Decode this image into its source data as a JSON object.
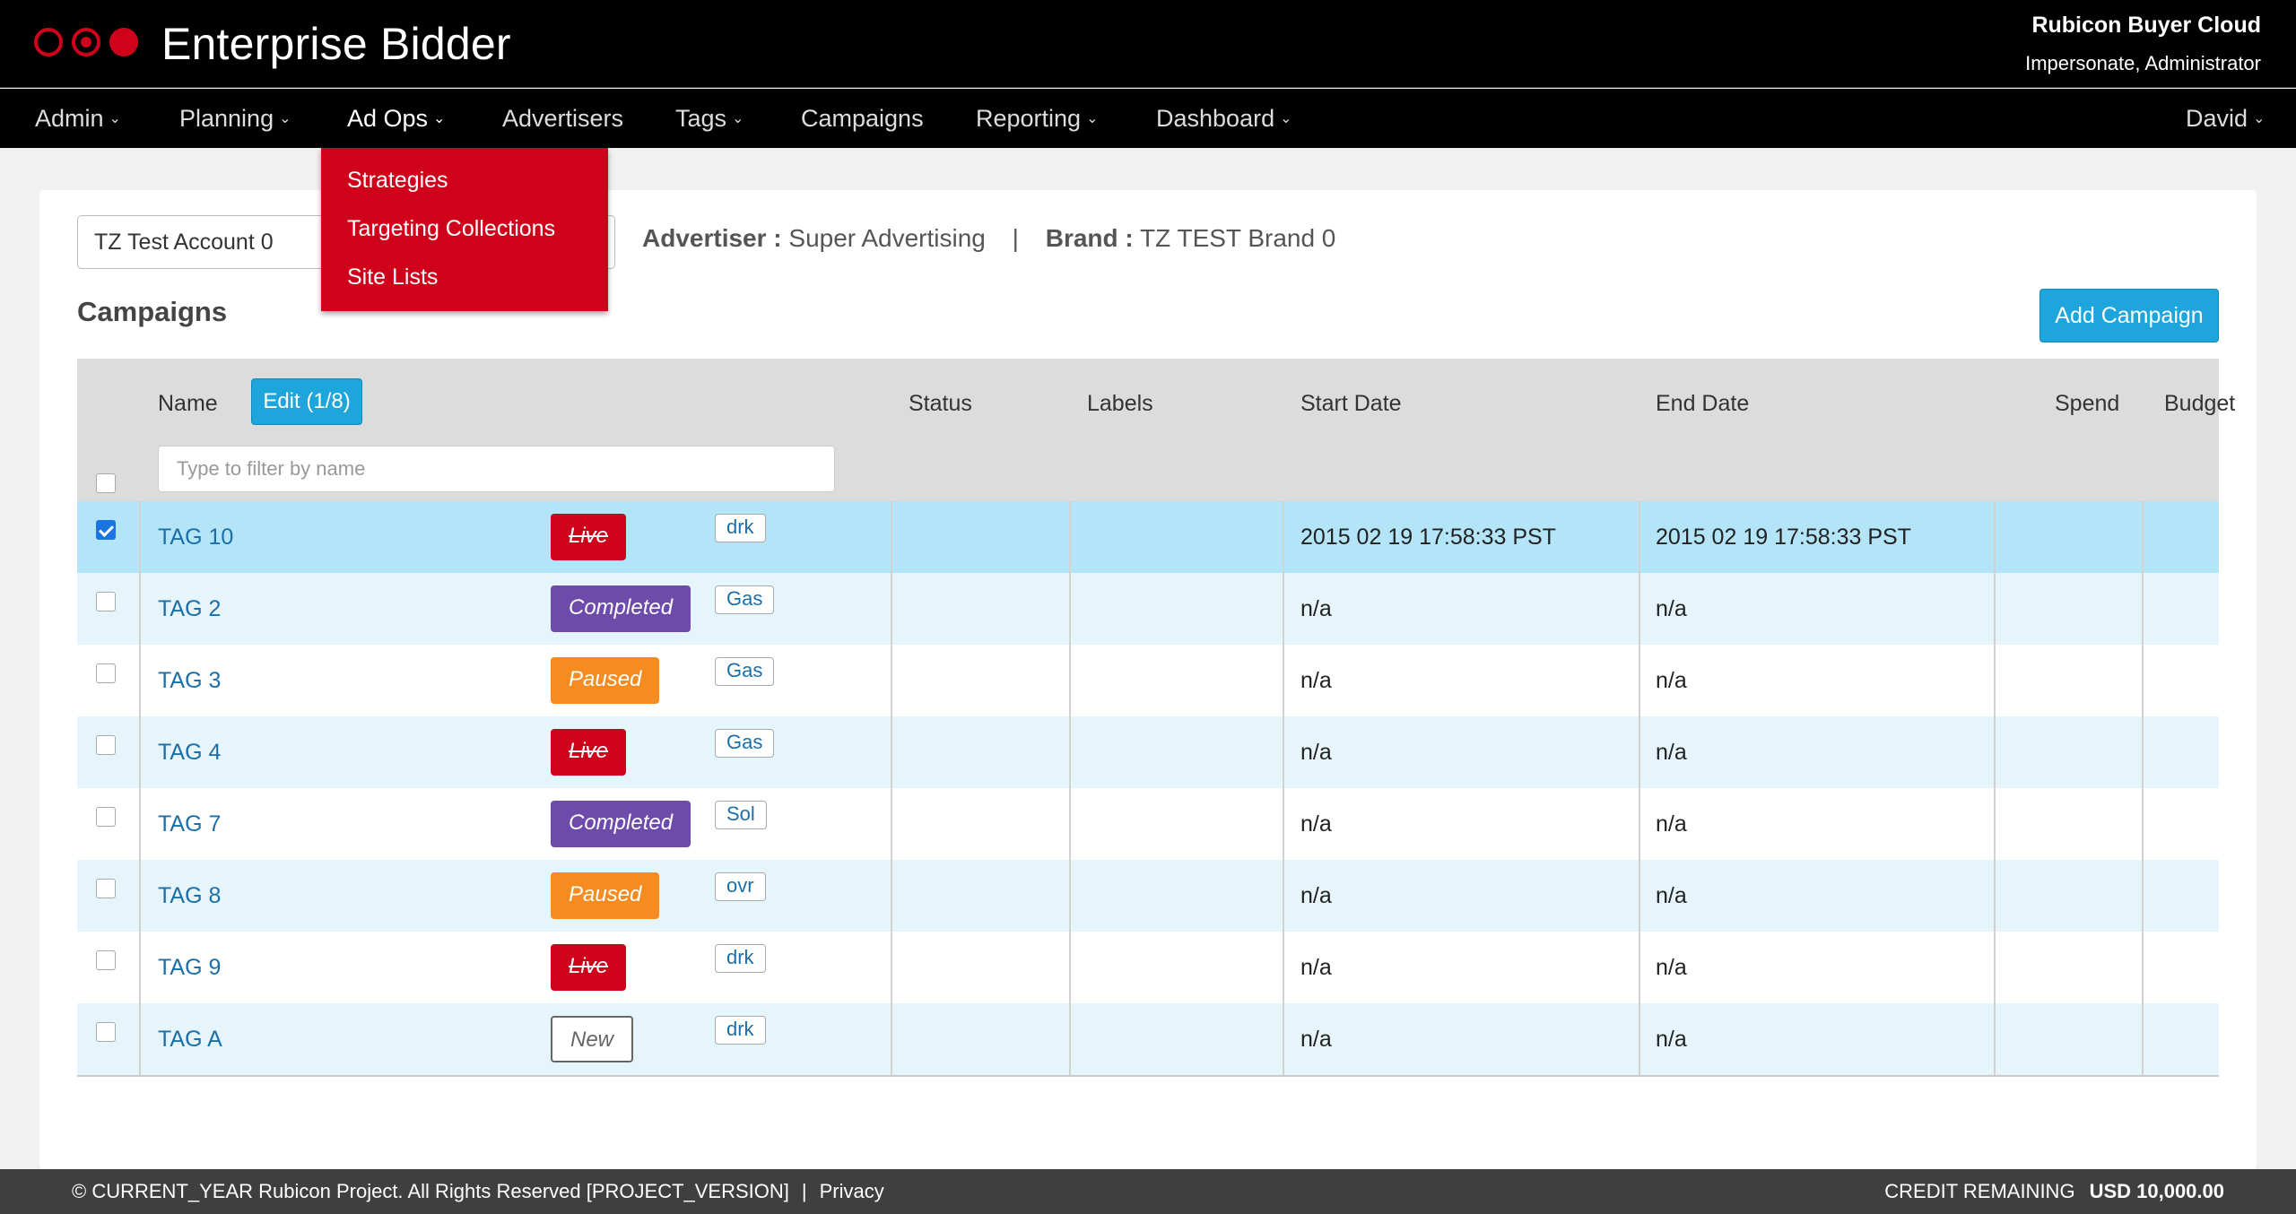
{
  "header": {
    "app_title": "Enterprise Bidder",
    "org_name": "Rubicon Buyer Cloud",
    "impersonate": "Impersonate, Administrator",
    "brand_color": "#d0021b"
  },
  "nav": {
    "items": [
      {
        "label": "Admin",
        "has_dropdown": true
      },
      {
        "label": "Planning",
        "has_dropdown": true
      },
      {
        "label": "Ad Ops",
        "has_dropdown": true,
        "active": true
      },
      {
        "label": "Advertisers",
        "has_dropdown": false
      },
      {
        "label": "Tags",
        "has_dropdown": true
      },
      {
        "label": "Campaigns",
        "has_dropdown": false
      },
      {
        "label": "Reporting",
        "has_dropdown": true
      },
      {
        "label": "Dashboard",
        "has_dropdown": true
      }
    ],
    "user": "David"
  },
  "adops_menu": {
    "items": [
      "Strategies",
      "Targeting Collections",
      "Site Lists"
    ]
  },
  "account": {
    "selected": "TZ Test Account 0",
    "advertiser_label": "Advertiser :",
    "advertiser": "Super Advertising",
    "separator": "|",
    "brand_label": "Brand :",
    "brand": "TZ TEST Brand 0"
  },
  "campaigns": {
    "heading": "Campaigns",
    "add_button": "Add Campaign",
    "edit_button": "Edit (1/8)",
    "filter_placeholder": "Type to filter by name",
    "columns": [
      "Name",
      "Status",
      "Labels",
      "Start Date",
      "End Date",
      "Spend",
      "Budget"
    ],
    "rows": [
      {
        "name": "TAG 10",
        "status": "Live",
        "label": "drk",
        "start": "2015 02 19 17:58:33 PST",
        "end": "2015 02 19 17:58:33 PST",
        "checked": true
      },
      {
        "name": "TAG 2",
        "status": "Completed",
        "label": "Gas",
        "start": "n/a",
        "end": "n/a",
        "checked": false
      },
      {
        "name": "TAG 3",
        "status": "Paused",
        "label": "Gas",
        "start": "n/a",
        "end": "n/a",
        "checked": false
      },
      {
        "name": "TAG 4",
        "status": "Live",
        "label": "Gas",
        "start": "n/a",
        "end": "n/a",
        "checked": false
      },
      {
        "name": "TAG 7",
        "status": "Completed",
        "label": "Sol",
        "start": "n/a",
        "end": "n/a",
        "checked": false
      },
      {
        "name": "TAG 8",
        "status": "Paused",
        "label": "ovr",
        "start": "n/a",
        "end": "n/a",
        "checked": false
      },
      {
        "name": "TAG 9",
        "status": "Live",
        "label": "drk",
        "start": "n/a",
        "end": "n/a",
        "checked": false
      },
      {
        "name": "TAG A",
        "status": "New",
        "label": "drk",
        "start": "n/a",
        "end": "n/a",
        "checked": false
      }
    ],
    "status_colors": {
      "Live": "#d0021b",
      "Completed": "#6e4bab",
      "Paused": "#f68b1f",
      "New": "#ffffff"
    }
  },
  "footer": {
    "copyright": "© CURRENT_YEAR Rubicon Project. All Rights Reserved  [PROJECT_VERSION]",
    "separator": "|",
    "privacy": "Privacy",
    "credit_label": "CREDIT REMAINING",
    "credit_value": "USD 10,000.00"
  }
}
